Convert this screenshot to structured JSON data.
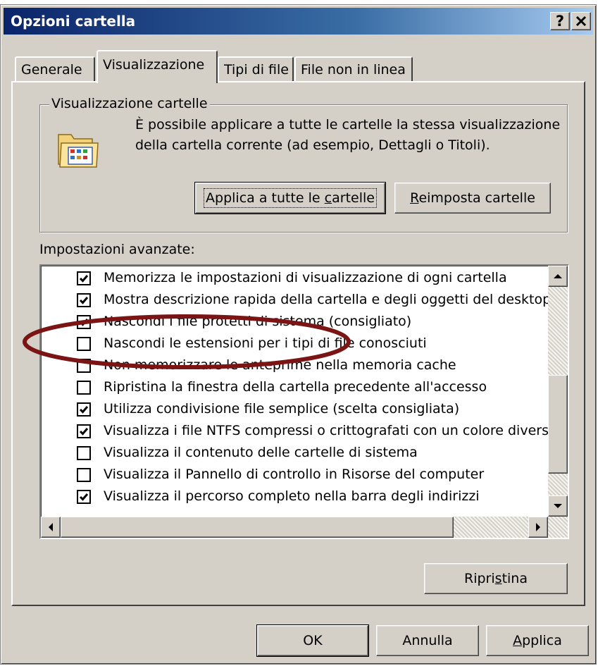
{
  "window": {
    "title": "Opzioni cartella",
    "help_label": "?",
    "close_label": "✕"
  },
  "tabs": [
    {
      "label": "Generale",
      "active": false
    },
    {
      "label": "Visualizzazione",
      "active": true
    },
    {
      "label": "Tipi di file",
      "active": false
    },
    {
      "label": "File non in linea",
      "active": false
    }
  ],
  "folder_views": {
    "group_label": "Visualizzazione cartelle",
    "description": "È possibile applicare a tutte le cartelle la stessa visualizzazione della cartella corrente (ad esempio, Dettagli o Titoli).",
    "apply_all_pre": "Applica a tutte le ",
    "apply_all_accel": "c",
    "apply_all_post": "artelle",
    "reset_accel": "R",
    "reset_post": "eimposta cartelle",
    "icon": "folder-view-icon"
  },
  "advanced": {
    "label": "Impostazioni avanzate:",
    "items": [
      {
        "label": "Memorizza le impostazioni di visualizzazione di ogni cartella",
        "checked": true
      },
      {
        "label": "Mostra descrizione rapida della cartella e degli oggetti del desktop",
        "checked": true
      },
      {
        "label": "Nascondi i file protetti di sistema (consigliato)",
        "checked": true
      },
      {
        "label": "Nascondi le estensioni per i tipi di file conosciuti",
        "checked": false
      },
      {
        "label": "Non memorizzare le anteprime nella memoria cache",
        "checked": false
      },
      {
        "label": "Ripristina la finestra della cartella precedente all'accesso",
        "checked": false
      },
      {
        "label": "Utilizza condivisione file semplice (scelta consigliata)",
        "checked": true
      },
      {
        "label": "Visualizza i file NTFS compressi o crittografati con un colore diverso",
        "checked": true
      },
      {
        "label": "Visualizza il contenuto delle cartelle di sistema",
        "checked": false
      },
      {
        "label": "Visualizza il Pannello di controllo in Risorse del computer",
        "checked": false
      },
      {
        "label": "Visualizza il percorso completo nella barra degli indirizzi",
        "checked": true
      }
    ],
    "highlighted_item": "Nascondi le estensioni per i tipi di file conosciuti",
    "highlight_color": "#7b1414"
  },
  "restore": {
    "pre": "Ripri",
    "accel": "s",
    "post": "tina"
  },
  "footer": {
    "ok_label": "OK",
    "cancel_label": "Annulla",
    "apply_accel": "A",
    "apply_post": "pplica"
  }
}
